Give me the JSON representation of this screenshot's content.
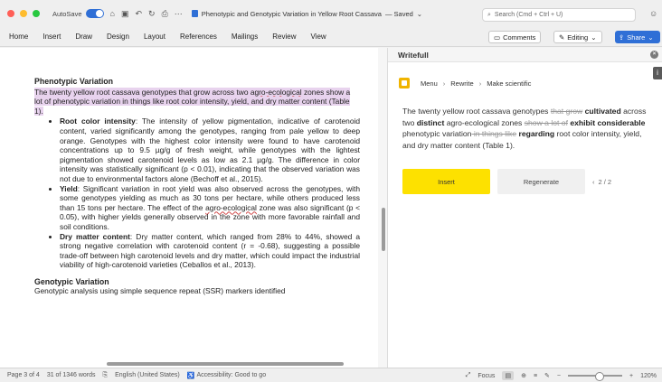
{
  "titlebar": {
    "autosave": "AutoSave",
    "doc_title": "Phenotypic and Genotypic Variation in Yellow Root Cassava",
    "saved_status": "— Saved",
    "search_placeholder": "Search (Cmd + Ctrl + U)"
  },
  "ribbon": {
    "tabs": [
      "Home",
      "Insert",
      "Draw",
      "Design",
      "Layout",
      "References",
      "Mailings",
      "Review",
      "View"
    ],
    "comments": "Comments",
    "editing": "Editing",
    "share": "Share"
  },
  "document": {
    "heading1": "Phenotypic Variation",
    "intro_a": "The twenty yellow root cassava genotypes that grow across two ",
    "intro_underlined": "agro-ecological",
    "intro_b": " zones show a lot of phenotypic variation in things like root color intensity, yield, and dry matter content (Table 1).",
    "bullets": [
      {
        "label": "Root color intensity",
        "text": ": The intensity of yellow pigmentation, indicative of carotenoid content, varied significantly among the genotypes, ranging from pale yellow to deep orange. Genotypes with the highest color intensity were found to have carotenoid concentrations up to 9.5 µg/g of fresh weight, while genotypes with the lightest pigmentation showed carotenoid levels as low as 2.1 µg/g. The difference in color intensity was statistically significant (p < 0.01), indicating that the observed variation was not due to environmental factors alone (Bechoff et al., 2015)."
      },
      {
        "label": "Yield",
        "text_a": ": Significant variation in root yield was also observed across the genotypes, with some genotypes yielding as much as 30 tons per hectare, while others produced less than 15 tons per hectare. The effect of the ",
        "underlined": "agro-ecological",
        "text_b": " zone was also significant (p < 0.05), with higher yields generally observed in the zone with more favorable rainfall and soil conditions."
      },
      {
        "label": "Dry matter content",
        "text": ": Dry matter content, which ranged from 28% to 44%, showed a strong negative correlation with carotenoid content (r = -0.68), suggesting a possible trade-off between high carotenoid levels and dry matter, which could impact the industrial viability of high-carotenoid varieties (Ceballos et al., 2013)."
      }
    ],
    "heading2": "Genotypic Variation",
    "para2": "Genotypic analysis using simple sequence repeat (SSR) markers identified"
  },
  "writefull": {
    "title": "Writefull",
    "crumbs": [
      "Menu",
      "Rewrite",
      "Make scientific"
    ],
    "s1": "The twenty yellow root cassava genotypes ",
    "s1_del": "that grow",
    "s1_add": "cultivated",
    "s2": "across two ",
    "s2_add": "distinct",
    "s3": " agro-ecological zones ",
    "s3_del": "show a lot of",
    "s3_add": "exhibit considerable",
    "s4": " phenotypic variation",
    "s4_del": " in things like",
    "s4_add": "regarding",
    "s5": " root color intensity, yield, and dry matter content (Table 1).",
    "insert": "Insert",
    "regenerate": "Regenerate",
    "pager": "2 / 2"
  },
  "status": {
    "page": "Page 3 of 4",
    "words": "31 of 1346 words",
    "language": "English (United States)",
    "accessibility": "Accessibility: Good to go",
    "focus": "Focus",
    "zoom": "120%"
  },
  "colors": {
    "accent": "#2f6fd6",
    "highlight": "#e8d3ee",
    "insert_btn": "#fde100"
  }
}
